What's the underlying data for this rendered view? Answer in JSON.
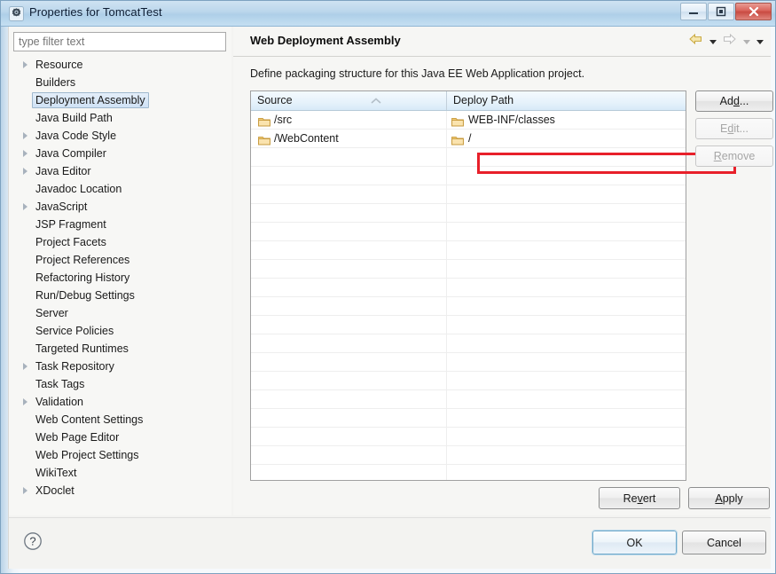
{
  "window": {
    "title": "Properties for TomcatTest",
    "icon": "gear-icon",
    "controls": {
      "minimize": "minimize-icon",
      "maximize": "restore-icon",
      "close": "close-icon"
    }
  },
  "sidebar": {
    "filter": {
      "placeholder": "type filter text",
      "value": ""
    },
    "items": [
      {
        "label": "Resource",
        "expandable": true,
        "selected": false
      },
      {
        "label": "Builders",
        "expandable": false,
        "selected": false
      },
      {
        "label": "Deployment Assembly",
        "expandable": false,
        "selected": true
      },
      {
        "label": "Java Build Path",
        "expandable": false,
        "selected": false
      },
      {
        "label": "Java Code Style",
        "expandable": true,
        "selected": false
      },
      {
        "label": "Java Compiler",
        "expandable": true,
        "selected": false
      },
      {
        "label": "Java Editor",
        "expandable": true,
        "selected": false
      },
      {
        "label": "Javadoc Location",
        "expandable": false,
        "selected": false
      },
      {
        "label": "JavaScript",
        "expandable": true,
        "selected": false
      },
      {
        "label": "JSP Fragment",
        "expandable": false,
        "selected": false
      },
      {
        "label": "Project Facets",
        "expandable": false,
        "selected": false
      },
      {
        "label": "Project References",
        "expandable": false,
        "selected": false
      },
      {
        "label": "Refactoring History",
        "expandable": false,
        "selected": false
      },
      {
        "label": "Run/Debug Settings",
        "expandable": false,
        "selected": false
      },
      {
        "label": "Server",
        "expandable": false,
        "selected": false
      },
      {
        "label": "Service Policies",
        "expandable": false,
        "selected": false
      },
      {
        "label": "Targeted Runtimes",
        "expandable": false,
        "selected": false
      },
      {
        "label": "Task Repository",
        "expandable": true,
        "selected": false
      },
      {
        "label": "Task Tags",
        "expandable": false,
        "selected": false
      },
      {
        "label": "Validation",
        "expandable": true,
        "selected": false
      },
      {
        "label": "Web Content Settings",
        "expandable": false,
        "selected": false
      },
      {
        "label": "Web Page Editor",
        "expandable": false,
        "selected": false
      },
      {
        "label": "Web Project Settings",
        "expandable": false,
        "selected": false
      },
      {
        "label": "WikiText",
        "expandable": false,
        "selected": false
      },
      {
        "label": "XDoclet",
        "expandable": true,
        "selected": false
      }
    ]
  },
  "page": {
    "title": "Web Deployment Assembly",
    "description": "Define packaging structure for this Java EE Web Application project.",
    "nav": {
      "back_icon": "back-arrow-icon",
      "back_menu_icon": "chevron-down-icon",
      "forward_icon": "forward-arrow-icon",
      "forward_menu_icon": "chevron-down-icon",
      "view_menu_icon": "chevron-down-icon"
    }
  },
  "table": {
    "columns": [
      "Source",
      "Deploy Path"
    ],
    "sort_indicator": "sort-ascending-icon",
    "rows": [
      {
        "source": "/src",
        "deploy": "WEB-INF/classes",
        "highlighted": false
      },
      {
        "source": "/WebContent",
        "deploy": "/",
        "highlighted": true
      }
    ],
    "empty_row_count": 20
  },
  "side_buttons": [
    {
      "label": "Add...",
      "mnemonic_index": 2,
      "enabled": true
    },
    {
      "label": "Edit...",
      "mnemonic_index": 1,
      "enabled": false
    },
    {
      "label": "Remove",
      "mnemonic_index": 0,
      "enabled": false
    }
  ],
  "page_buttons": {
    "revert": {
      "pre": "Re",
      "mn": "v",
      "post": "ert"
    },
    "apply": {
      "pre": "",
      "mn": "A",
      "post": "pply"
    }
  },
  "footer": {
    "help_icon": "help-question-icon",
    "ok": "OK",
    "cancel": "Cancel"
  },
  "colors": {
    "annotation": "#e8202a",
    "title_bar": "#bcd7ec",
    "selection": "#cfe2f5",
    "folder": "#f5d07a",
    "back_arrow": "#f2e09a"
  }
}
